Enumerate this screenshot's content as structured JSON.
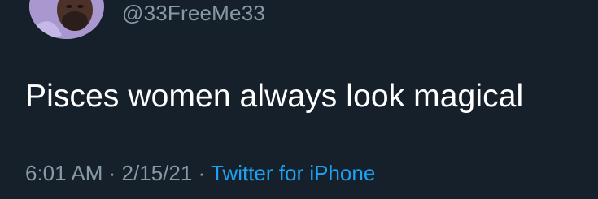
{
  "tweet": {
    "handle": "@33FreeMe33",
    "text": "Pisces women always look magical",
    "time": "6:01 AM",
    "separator": "·",
    "date": "2/15/21",
    "source": "Twitter for iPhone"
  },
  "colors": {
    "background": "#15202b",
    "text": "#ffffff",
    "secondary_text": "#8899a6",
    "link": "#1da1f2"
  }
}
